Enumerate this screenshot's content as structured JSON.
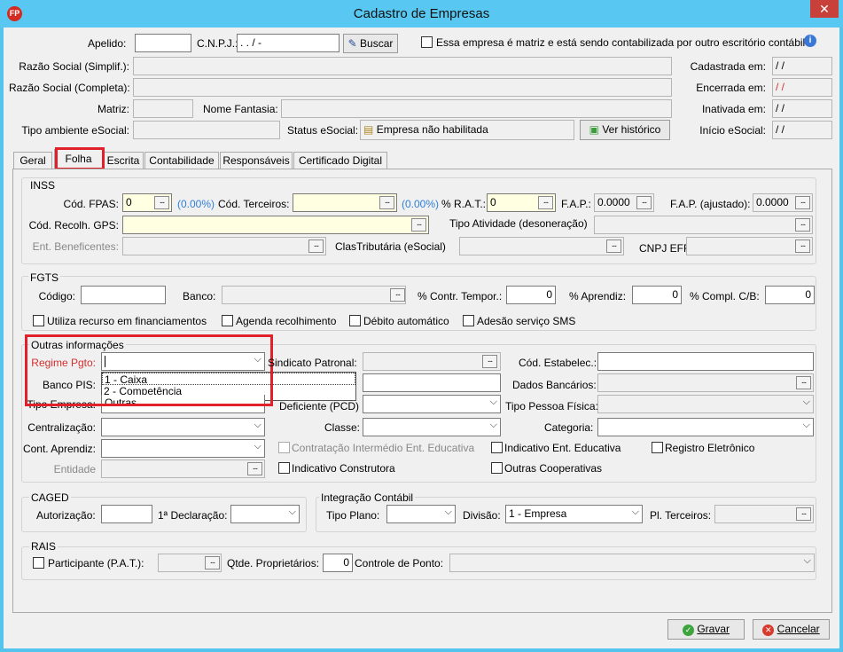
{
  "window": {
    "title": "Cadastro de Empresas",
    "app_icon": "FP",
    "close": "✕"
  },
  "header": {
    "apelido_label": "Apelido:",
    "apelido_value": "",
    "cnpj_label": "C.N.P.J.:",
    "cnpj_value": " .  .  /   -",
    "buscar_label": "Buscar",
    "matriz_check_label": "Essa empresa é matriz e está sendo contabilizada por outro escritório contábil",
    "razao_simpl_label": "Razão Social (Simplif.):",
    "razao_compl_label": "Razão Social (Completa):",
    "matriz_label": "Matriz:",
    "nome_fantasia_label": "Nome Fantasia:",
    "tipo_amb_label": "Tipo ambiente eSocial:",
    "status_esocial_label": "Status eSocial:",
    "status_esocial_value": "Empresa não habilitada",
    "ver_historico_label": "Ver histórico",
    "cadastrada_label": "Cadastrada em:",
    "cadastrada_value": " / /",
    "encerrada_label": "Encerrada em:",
    "encerrada_value": " / /",
    "inativada_label": "Inativada em:",
    "inativada_value": " / /",
    "inicio_esocial_label": "Início eSocial:",
    "inicio_esocial_value": " / /"
  },
  "tabs": [
    "Geral",
    "Folha",
    "Escrita",
    "Contabilidade",
    "Responsáveis",
    "Certificado Digital"
  ],
  "inss": {
    "title": "INSS",
    "fpas_label": "Cód. FPAS:",
    "fpas_value": "0",
    "fpas_pct": "(0.00%)",
    "terceiros_label": "Cód. Terceiros:",
    "terceiros_pct": "(0.00%)",
    "rat_label": "% R.A.T.:",
    "rat_value": "0",
    "fap_label": "F.A.P.:",
    "fap_value": "0.0000",
    "fap_aj_label": "F.A.P. (ajustado):",
    "fap_aj_value": "0.0000",
    "gps_label": "Cód. Recolh. GPS:",
    "tipo_ativ_label": "Tipo Atividade (desoneração)",
    "ent_benef_label": "Ent. Beneficentes:",
    "clastrib_label": "ClasTributária (eSocial)",
    "cnpj_efr_label": "CNPJ EFR"
  },
  "fgts": {
    "title": "FGTS",
    "codigo_label": "Código:",
    "banco_label": "Banco:",
    "contr_tempor_label": "% Contr. Tempor.:",
    "contr_tempor_value": "0",
    "aprendiz_label": "% Aprendiz:",
    "aprendiz_value": "0",
    "compl_label": "% Compl. C/B:",
    "compl_value": "0",
    "check1": "Utiliza recurso em financiamentos",
    "check2": "Agenda recolhimento",
    "check3": "Débito automático",
    "check4": "Adesão serviço SMS"
  },
  "outras": {
    "title": "Outras informações",
    "regime_label": "Regime Pgto:",
    "regime_options": [
      "1 - Caixa",
      "2 - Competência"
    ],
    "banco_pis_label": "Banco PIS:",
    "tipo_empresa_label": "Tipo Empresa:",
    "tipo_empresa_value": "Outras",
    "centralizacao_label": "Centralização:",
    "cont_aprendiz_label": "Cont. Aprendiz:",
    "entidade_label": "Entidade",
    "sindicato_label": "Sindicato Patronal:",
    "deficiente_label": "Deficiente (PCD)",
    "classe_label": "Classe:",
    "contratacao_label": "Contratação Intermédio Ent. Educativa",
    "ind_construtora_label": "Indicativo Construtora",
    "cod_estab_label": "Cód. Estabelec.:",
    "dados_banc_label": "Dados Bancários:",
    "tipo_pf_label": "Tipo Pessoa Física:",
    "categoria_label": "Categoria:",
    "ind_ent_educ_label": "Indicativo Ent. Educativa",
    "registro_elet_label": "Registro Eletrônico",
    "outras_coop_label": "Outras Cooperativas"
  },
  "caged": {
    "title": "CAGED",
    "autorizacao_label": "Autorização:",
    "declaracao_label": "1ª Declaração:"
  },
  "integracao": {
    "title": "Integração Contábil",
    "tipo_plano_label": "Tipo Plano:",
    "divisao_label": "Divisão:",
    "divisao_value": "1 - Empresa",
    "pl_terceiros_label": "Pl. Terceiros:"
  },
  "rais": {
    "title": "RAIS",
    "participante_label": "Participante (P.A.T.):",
    "qtde_prop_label": "Qtde. Proprietários:",
    "qtde_prop_value": "0",
    "controle_ponto_label": "Controle de Ponto:"
  },
  "footer": {
    "gravar_label": "Gravar",
    "cancelar_label": "Cancelar"
  }
}
